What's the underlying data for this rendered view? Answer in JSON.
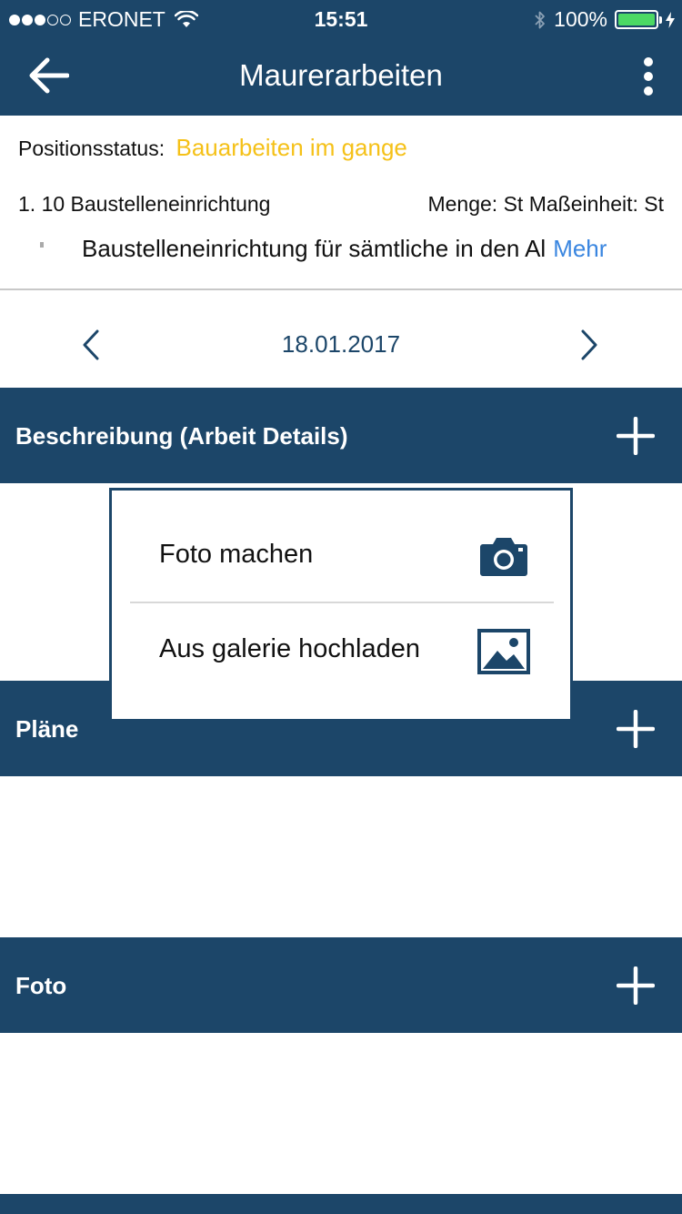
{
  "status_bar": {
    "carrier": "ERONET",
    "time": "15:51",
    "battery": "100%",
    "signal_bars_filled": 3,
    "signal_bars_total": 5
  },
  "navbar": {
    "title": "Maurerarbeiten",
    "back_icon": "arrow-left-icon",
    "menu_icon": "more-vertical-icon"
  },
  "position": {
    "status_label": "Positionsstatus:",
    "status_value": "Bauarbeiten im gange",
    "number": "1. 10 Baustelleneinrichtung",
    "meta": "Menge: St Maßeinheit: St",
    "description": "Baustelleneinrichtung für sämtliche in den Al",
    "more_label": "Mehr"
  },
  "date_nav": {
    "date": "18.01.2017"
  },
  "sections": [
    {
      "title": "Beschreibung (Arbeit Details)"
    },
    {
      "title": "Pläne"
    },
    {
      "title": "Foto"
    }
  ],
  "popup": {
    "items": [
      {
        "label": "Foto machen",
        "icon": "camera-icon"
      },
      {
        "label": "Aus galerie hochladen",
        "icon": "image-icon"
      }
    ]
  },
  "colors": {
    "primary": "#1c4669",
    "status_value": "#f5c118",
    "link": "#3a86e0",
    "battery": "#4cd964"
  }
}
